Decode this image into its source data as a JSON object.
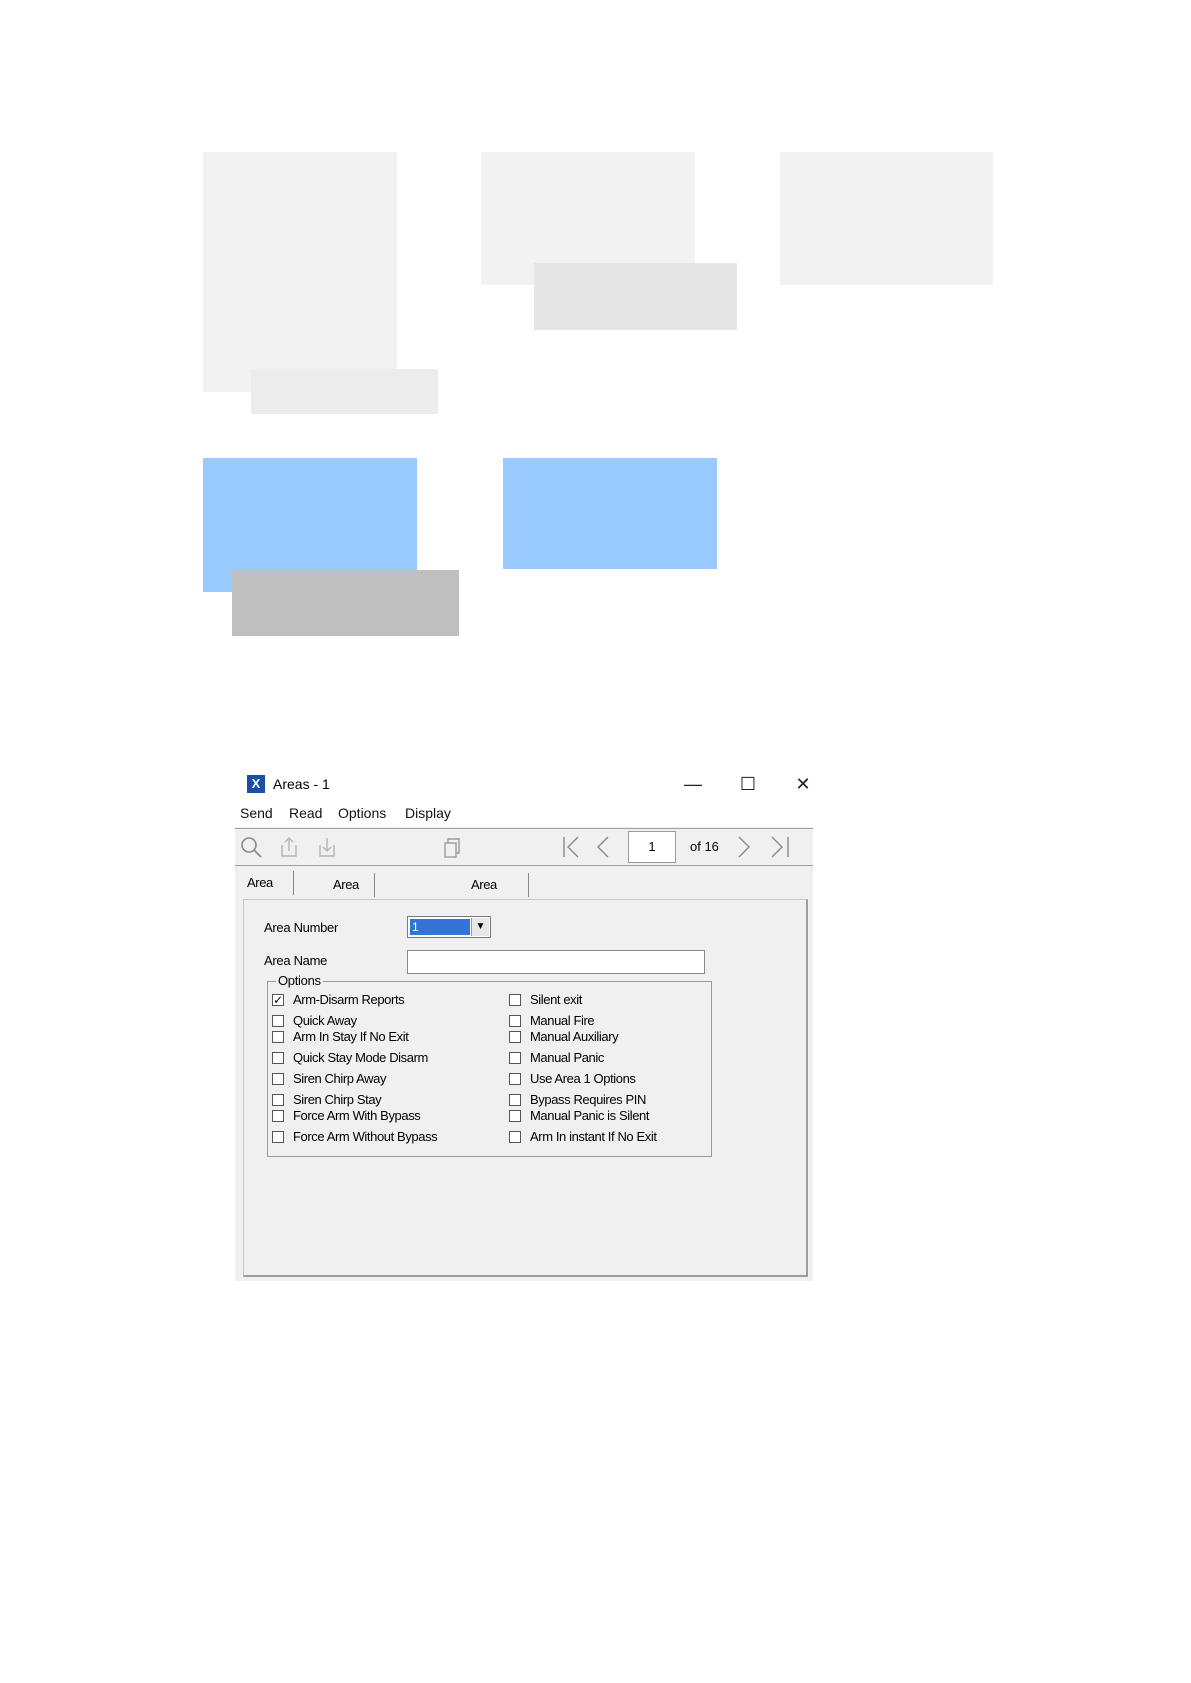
{
  "window": {
    "title": "Areas - 1",
    "minimize": "—",
    "maximize": "☐",
    "close": "✕"
  },
  "menu": [
    "Send",
    "Read",
    "Options",
    "Display"
  ],
  "toolbar": {
    "icons": [
      "search-icon",
      "upload-icon",
      "download-icon",
      "copy-icon",
      "first-page-icon",
      "previous-page-icon",
      "next-page-icon",
      "last-page-icon"
    ],
    "page": "1",
    "of_label": "of 16"
  },
  "tabs": [
    "Area Options",
    "Area Type and Timers",
    "Area Event Reporting"
  ],
  "form": {
    "area_number_label": "Area Number",
    "area_number_value": "1",
    "area_name_label": "Area Name",
    "area_name_value": "",
    "options_label": "Options"
  },
  "options_left": [
    {
      "label": "Arm-Disarm Reports",
      "checked": true
    },
    {
      "label": "Quick Away",
      "checked": false
    },
    {
      "label": "Arm In Stay If No Exit",
      "checked": false
    },
    {
      "label": "Quick Stay Mode Disarm",
      "checked": false
    },
    {
      "label": "Siren Chirp Away",
      "checked": false
    },
    {
      "label": "Siren Chirp Stay",
      "checked": false
    },
    {
      "label": "Force Arm With Bypass",
      "checked": false
    },
    {
      "label": "Force Arm Without Bypass",
      "checked": false
    }
  ],
  "options_right": [
    {
      "label": "Silent exit",
      "checked": false
    },
    {
      "label": "Manual Fire",
      "checked": false
    },
    {
      "label": "Manual Auxiliary",
      "checked": false
    },
    {
      "label": "Manual Panic",
      "checked": false
    },
    {
      "label": "Use Area 1 Options",
      "checked": false
    },
    {
      "label": "Bypass Requires PIN",
      "checked": false
    },
    {
      "label": "Manual Panic is Silent",
      "checked": false
    },
    {
      "label": "Arm In instant If No Exit",
      "checked": false
    }
  ],
  "colors": {
    "placeholder_light": "#f2f2f2",
    "placeholder_mid": "#e6e6e6",
    "placeholder_blue": "#99caff",
    "placeholder_gray": "#bfbfbf",
    "selection_blue": "#3375d7"
  }
}
